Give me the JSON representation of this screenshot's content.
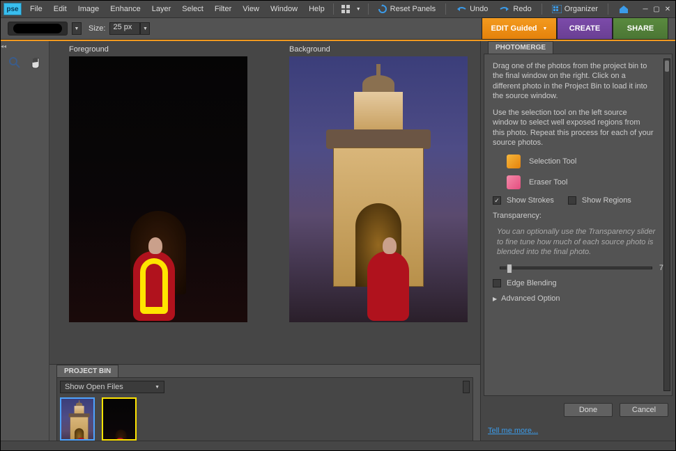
{
  "app": {
    "logo": "pse"
  },
  "menu": {
    "file": "File",
    "edit": "Edit",
    "image": "Image",
    "enhance": "Enhance",
    "layer": "Layer",
    "select": "Select",
    "filter": "Filter",
    "view": "View",
    "window": "Window",
    "help": "Help"
  },
  "toolbar_right": {
    "reset_panels": "Reset Panels",
    "undo": "Undo",
    "redo": "Redo",
    "organizer": "Organizer"
  },
  "options": {
    "size_label": "Size:",
    "size_value": "25 px"
  },
  "modes": {
    "edit": "EDIT Guided",
    "create": "CREATE",
    "share": "SHARE"
  },
  "canvas": {
    "foreground_label": "Foreground",
    "background_label": "Background"
  },
  "bin": {
    "title": "PROJECT BIN",
    "filter": "Show Open Files"
  },
  "panel": {
    "title": "PHOTOMERGE",
    "intro1": "Drag one of the photos from the project bin to the final window on the right. Click on a different photo in the Project Bin to load it into the source window.",
    "intro2": "Use the selection tool on the left source window to select well exposed regions from this photo. Repeat this process for each of your source photos.",
    "selection_tool": "Selection Tool",
    "eraser_tool": "Eraser Tool",
    "show_strokes": "Show Strokes",
    "show_regions": "Show Regions",
    "transparency": "Transparency:",
    "transparency_hint": "You can optionally use the Transparency slider to fine tune how much of each source photo is blended into the final photo.",
    "transparency_value": "7",
    "edge_blending": "Edge Blending",
    "advanced": "Advanced Option",
    "done": "Done",
    "cancel": "Cancel",
    "tell_me_more": "Tell me more..."
  }
}
